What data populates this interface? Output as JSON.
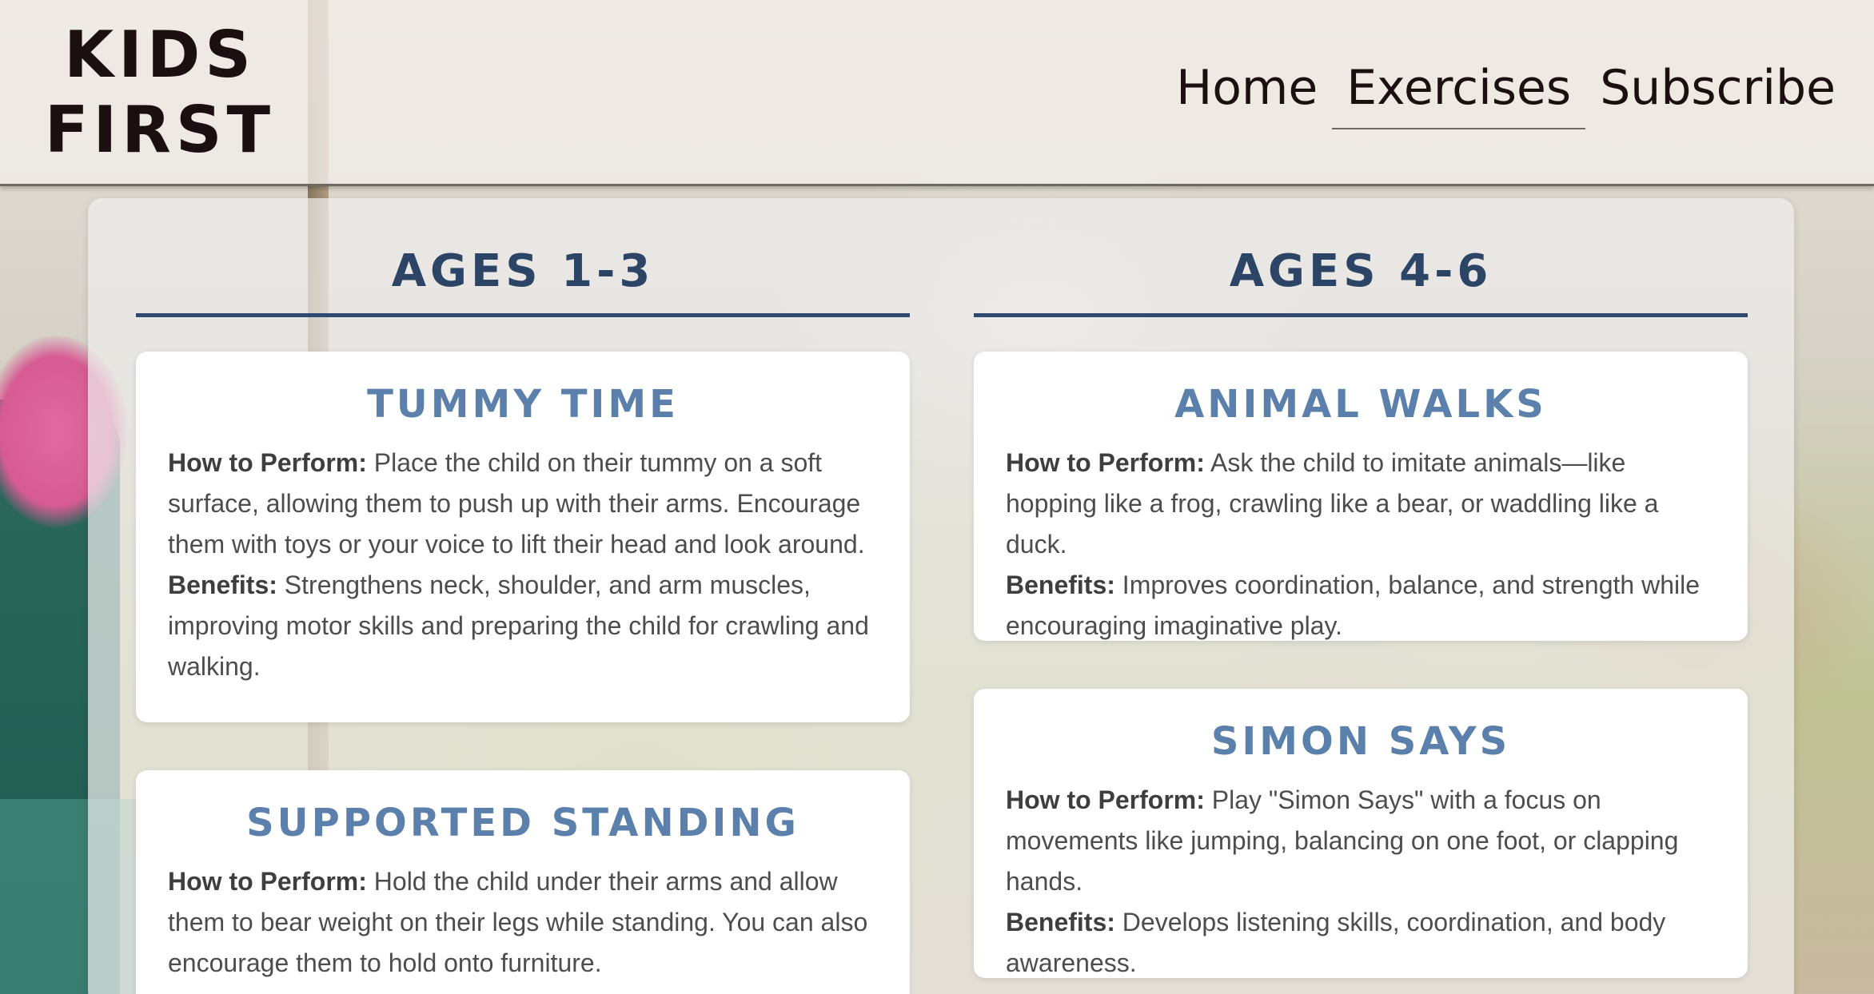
{
  "header": {
    "logo_line1": "KIDS",
    "logo_line2": "FIRST",
    "nav": [
      {
        "label": "Home",
        "active": false
      },
      {
        "label": "Exercises",
        "active": true
      },
      {
        "label": "Subscribe",
        "active": false
      }
    ]
  },
  "columns": [
    {
      "heading": "AGES 1-3",
      "cards": [
        {
          "title": "TUMMY TIME",
          "how_label": "How to Perform:",
          "how_text": " Place the child on their tummy on a soft surface, allowing them to push up with their arms. Encourage them with toys or your voice to lift their head and look around.",
          "benefits_label": "Benefits:",
          "benefits_text": " Strengthens neck, shoulder, and arm muscles, improving motor skills and preparing the child for crawling and walking."
        },
        {
          "title": "SUPPORTED STANDING",
          "how_label": "How to Perform:",
          "how_text": " Hold the child under their arms and allow them to bear weight on their legs while standing. You can also encourage them to hold onto furniture.",
          "benefits_label": "",
          "benefits_text": ""
        }
      ]
    },
    {
      "heading": "AGES 4-6",
      "cards": [
        {
          "title": "ANIMAL WALKS",
          "how_label": "How to Perform:",
          "how_text": " Ask the child to imitate animals—like hopping like a frog, crawling like a bear, or waddling like a duck.",
          "benefits_label": "Benefits:",
          "benefits_text": " Improves coordination, balance, and strength while encouraging imaginative play."
        },
        {
          "title": "SIMON SAYS",
          "how_label": "How to Perform:",
          "how_text": " Play \"Simon Says\" with a focus on movements like jumping, balancing on one foot, or clapping hands.",
          "benefits_label": "Benefits:",
          "benefits_text": " Develops listening skills, coordination, and body awareness."
        }
      ]
    }
  ]
}
